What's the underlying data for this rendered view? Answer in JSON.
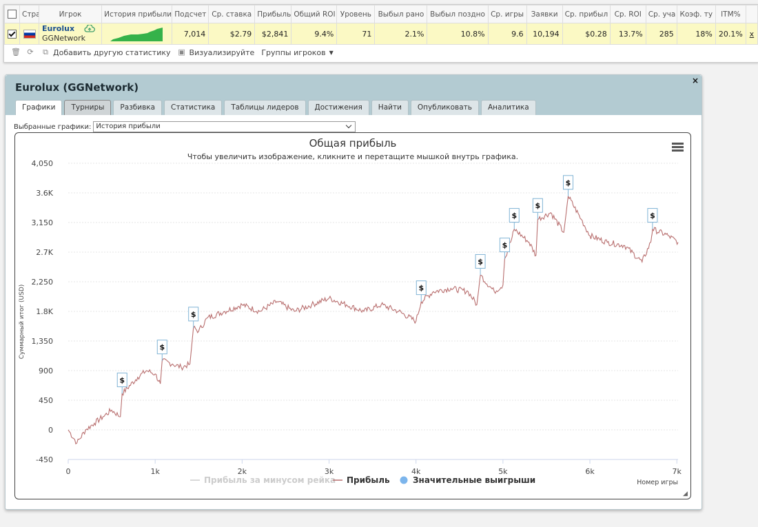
{
  "stats_table": {
    "headers": [
      "Стра",
      "Игрок",
      "История прибыли",
      "Подсчет",
      "Ср. ставка",
      "Прибыль",
      "Общий ROI",
      "Уровень",
      "Выбыл рано",
      "Выбыл поздно",
      "Ср. игры",
      "Заявки",
      "Ср. прибыл",
      "Ср. ROI",
      "Ср. уча",
      "Коэф. ту",
      "ITM%"
    ],
    "row": {
      "player": "Eurolux",
      "network": "GGNetwork",
      "cells": [
        "7,014",
        "$2.79",
        "$2,841",
        "9.4%",
        "71",
        "2.1%",
        "10.8%",
        "9.6",
        "10,194",
        "$0.28",
        "13.7%",
        "285",
        "18%",
        "20.1%"
      ],
      "remove": "x"
    },
    "toolbar": {
      "add_stats": "Добавить другую статистику",
      "visualize": "Визуализируйте",
      "groups": "Группы игроков"
    }
  },
  "panel": {
    "title": "Eurolux (GGNetwork)",
    "close": "×",
    "tabs": [
      "Графики",
      "Турниры",
      "Разбивка",
      "Статистика",
      "Таблицы лидеров",
      "Достижения",
      "Найти",
      "Опубликовать",
      "Аналитика"
    ],
    "selected_label": "Выбранные графики:",
    "selected_value": "История прибыли"
  },
  "chart_data": {
    "type": "line",
    "title": "Общая прибыль",
    "subtitle": "Чтобы увеличить изображение, кликните и перетащите мышкой внутрь графика.",
    "xlabel": "Номер игры",
    "ylabel": "Суммарный итог (USD)",
    "xlim": [
      0,
      7014
    ],
    "ylim": [
      -450,
      4050
    ],
    "xticks": [
      "0",
      "1k",
      "2k",
      "3k",
      "4k",
      "5k",
      "6k",
      "7k"
    ],
    "yticks": [
      "4,050",
      "3.6K",
      "3,150",
      "2.7K",
      "2,250",
      "1.8K",
      "1,350",
      "900",
      "450",
      "0",
      "-450"
    ],
    "grid": true,
    "legend_position": "bottom",
    "legend": [
      "Прибыль за минусом рейка",
      "Прибыль",
      "Значительные выигрыши"
    ],
    "series": [
      {
        "name": "Прибыль",
        "color": "#b86e6e",
        "points": [
          [
            0,
            0
          ],
          [
            100,
            -200
          ],
          [
            200,
            0
          ],
          [
            300,
            100
          ],
          [
            400,
            200
          ],
          [
            500,
            300
          ],
          [
            600,
            200
          ],
          [
            620,
            550
          ],
          [
            800,
            800
          ],
          [
            900,
            900
          ],
          [
            1000,
            850
          ],
          [
            1060,
            700
          ],
          [
            1080,
            1050
          ],
          [
            1200,
            1000
          ],
          [
            1300,
            950
          ],
          [
            1400,
            1000
          ],
          [
            1440,
            1550
          ],
          [
            1500,
            1500
          ],
          [
            1600,
            1700
          ],
          [
            1800,
            1800
          ],
          [
            2000,
            1900
          ],
          [
            2200,
            1800
          ],
          [
            2400,
            1950
          ],
          [
            2600,
            1800
          ],
          [
            2800,
            1900
          ],
          [
            3000,
            2000
          ],
          [
            3200,
            1900
          ],
          [
            3400,
            1800
          ],
          [
            3600,
            1900
          ],
          [
            3800,
            1800
          ],
          [
            4000,
            1650
          ],
          [
            4060,
            1950
          ],
          [
            4200,
            2100
          ],
          [
            4400,
            2150
          ],
          [
            4600,
            2100
          ],
          [
            4700,
            1900
          ],
          [
            4740,
            2350
          ],
          [
            4900,
            2100
          ],
          [
            5000,
            2200
          ],
          [
            5020,
            2600
          ],
          [
            5100,
            2900
          ],
          [
            5130,
            3050
          ],
          [
            5300,
            2850
          ],
          [
            5380,
            2650
          ],
          [
            5400,
            3200
          ],
          [
            5550,
            3300
          ],
          [
            5700,
            3000
          ],
          [
            5750,
            3550
          ],
          [
            5900,
            3200
          ],
          [
            6000,
            2950
          ],
          [
            6200,
            2850
          ],
          [
            6400,
            2800
          ],
          [
            6600,
            2550
          ],
          [
            6700,
            2850
          ],
          [
            6720,
            3050
          ],
          [
            6900,
            2950
          ],
          [
            7014,
            2850
          ]
        ]
      }
    ],
    "big_wins": [
      [
        620,
        550
      ],
      [
        1080,
        1050
      ],
      [
        1440,
        1550
      ],
      [
        4060,
        1950
      ],
      [
        4740,
        2350
      ],
      [
        5020,
        2600
      ],
      [
        5130,
        3050
      ],
      [
        5400,
        3200
      ],
      [
        5750,
        3550
      ],
      [
        6720,
        3050
      ]
    ],
    "marker_label": "$"
  }
}
